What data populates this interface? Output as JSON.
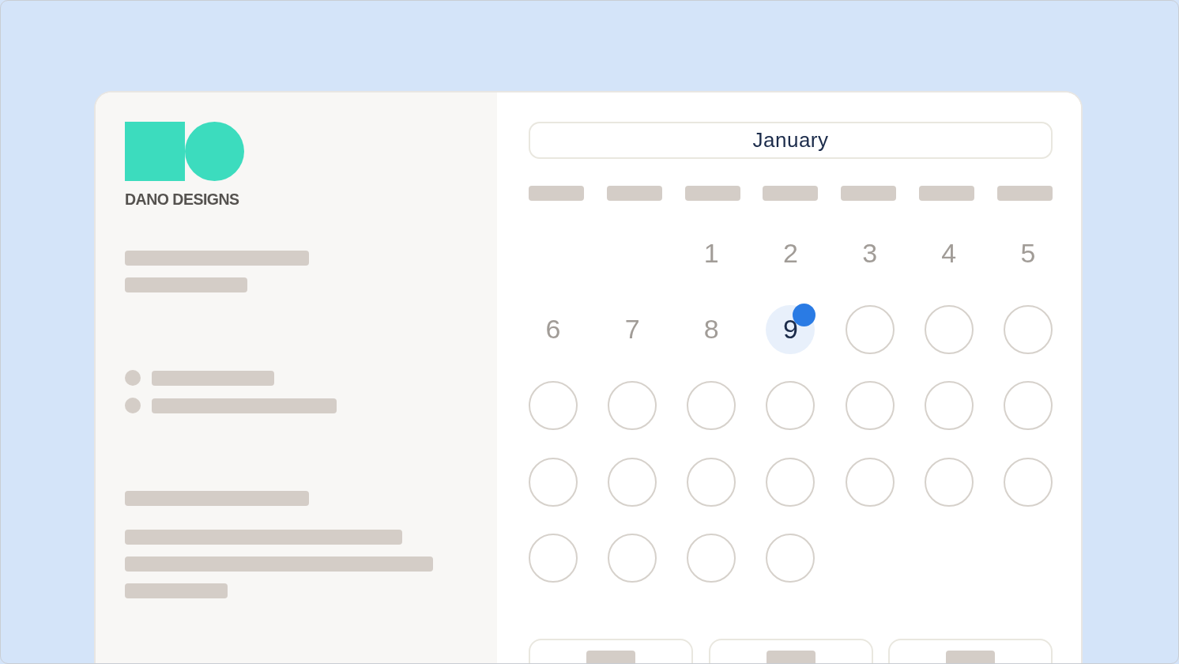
{
  "brand": {
    "name": "DANO DESIGNS"
  },
  "calendar": {
    "month": "January",
    "days": [
      {
        "kind": "blank"
      },
      {
        "kind": "blank"
      },
      {
        "kind": "number",
        "label": "1",
        "selected": false
      },
      {
        "kind": "number",
        "label": "2",
        "selected": false
      },
      {
        "kind": "number",
        "label": "3",
        "selected": false
      },
      {
        "kind": "number",
        "label": "4",
        "selected": false
      },
      {
        "kind": "number",
        "label": "5",
        "selected": false
      },
      {
        "kind": "number",
        "label": "6",
        "selected": false
      },
      {
        "kind": "number",
        "label": "7",
        "selected": false
      },
      {
        "kind": "number",
        "label": "8",
        "selected": false
      },
      {
        "kind": "number",
        "label": "9",
        "selected": true
      },
      {
        "kind": "slot",
        "selected": false
      },
      {
        "kind": "slot",
        "selected": false
      },
      {
        "kind": "slot",
        "selected": false
      },
      {
        "kind": "slot",
        "selected": false
      },
      {
        "kind": "slot",
        "selected": false
      },
      {
        "kind": "slot",
        "selected": false
      },
      {
        "kind": "slot",
        "selected": false
      },
      {
        "kind": "slot",
        "selected": false
      },
      {
        "kind": "slot",
        "selected": false
      },
      {
        "kind": "slot",
        "selected": false
      },
      {
        "kind": "slot",
        "selected": false
      },
      {
        "kind": "slot",
        "selected": false
      },
      {
        "kind": "slot",
        "selected": false
      },
      {
        "kind": "slot",
        "selected": false
      },
      {
        "kind": "slot",
        "selected": false
      },
      {
        "kind": "slot",
        "selected": false
      },
      {
        "kind": "slot",
        "selected": false
      },
      {
        "kind": "slot",
        "selected": false
      },
      {
        "kind": "slot",
        "selected": false
      },
      {
        "kind": "slot",
        "selected": false
      },
      {
        "kind": "slot",
        "selected": false
      }
    ]
  }
}
